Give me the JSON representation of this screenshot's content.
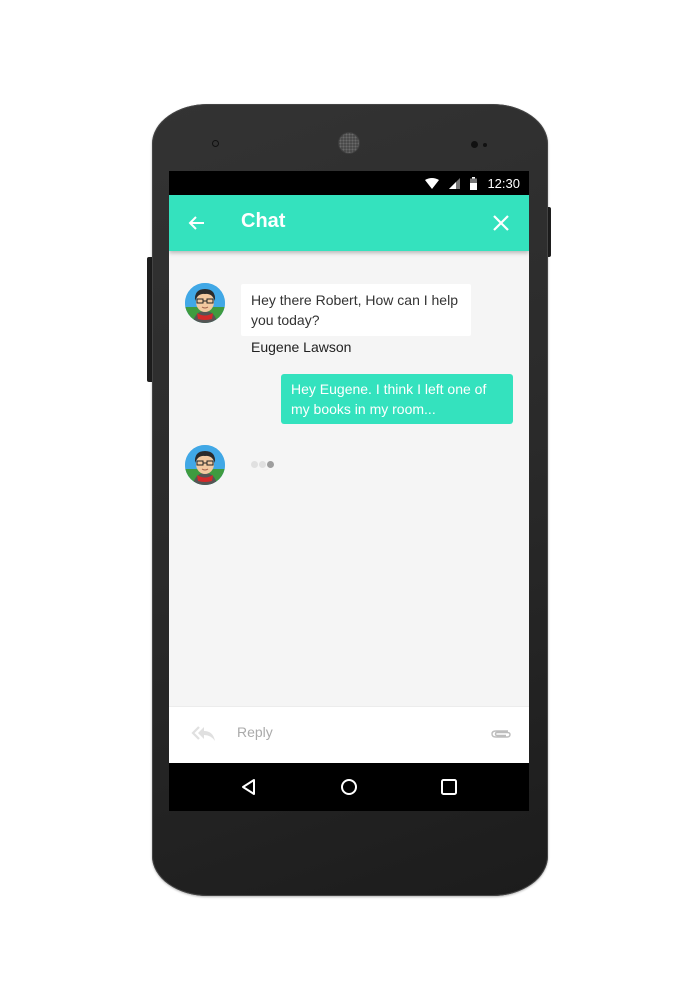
{
  "statusbar": {
    "time": "12:30",
    "icons": [
      "wifi-icon",
      "signal-icon",
      "battery-icon"
    ]
  },
  "appbar": {
    "title": "Chat",
    "back_icon": "arrow-left-icon",
    "close_icon": "close-icon",
    "color": "#34e2be"
  },
  "messages": [
    {
      "direction": "incoming",
      "text": "Hey there Robert, How can I help you today?",
      "sender": "Eugene Lawson",
      "avatar": "avatar-eugene"
    },
    {
      "direction": "outgoing",
      "text": "Hey Eugene. I think I left one of my books in my room..."
    }
  ],
  "typing_indicator": {
    "avatar": "avatar-eugene",
    "dots": 3,
    "active_dot": 3
  },
  "composer": {
    "placeholder": "Reply",
    "value": "",
    "reply_icon": "reply-all-icon",
    "attach_icon": "paperclip-icon"
  },
  "navbar": {
    "buttons": [
      "back-triangle-icon",
      "home-circle-icon",
      "recents-square-icon"
    ]
  }
}
